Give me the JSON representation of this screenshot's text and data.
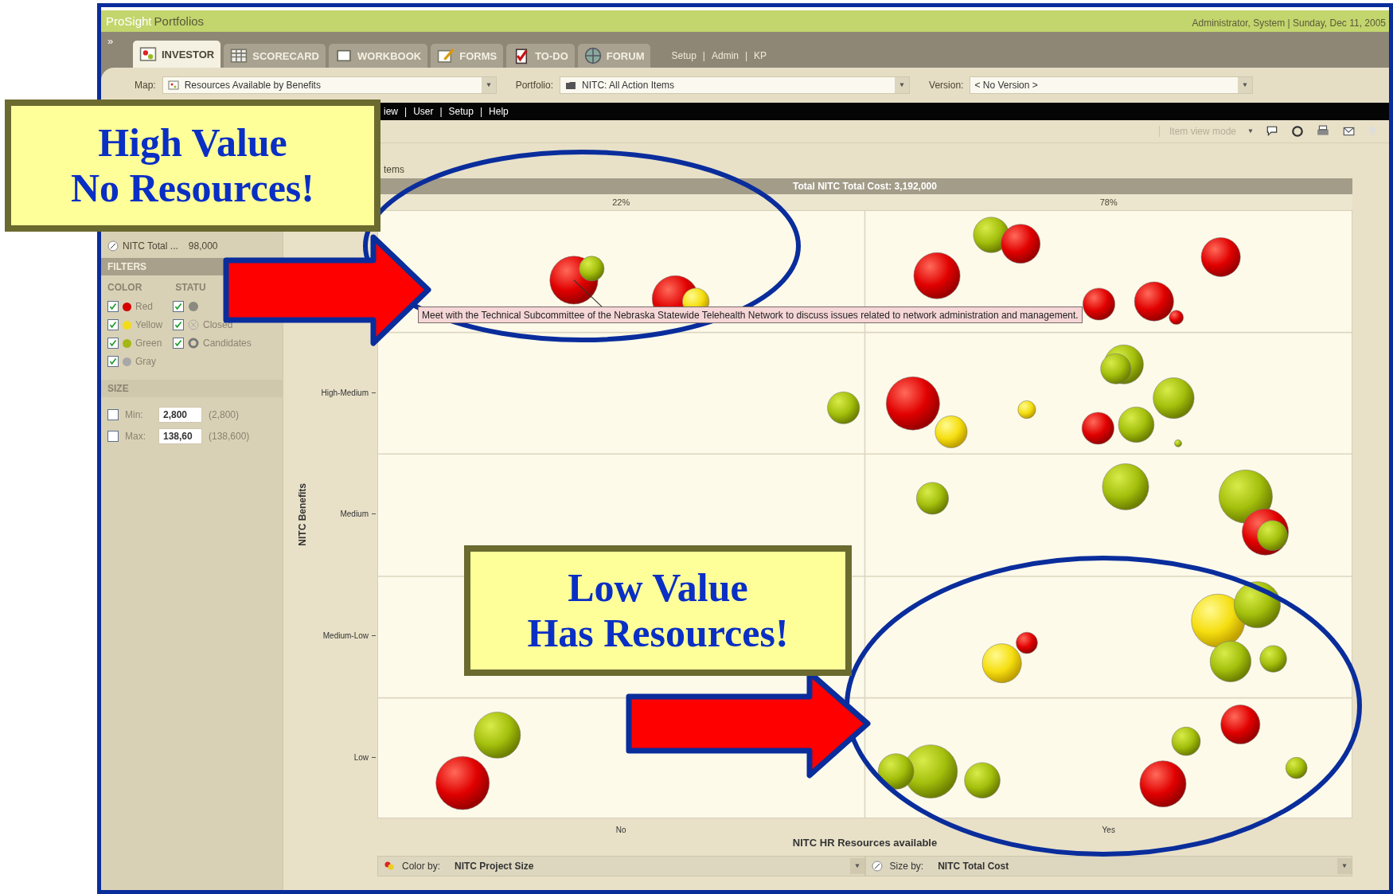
{
  "app": {
    "brand": "ProSight",
    "product": "Portfolios",
    "user_info": "Administrator, System | Sunday, Dec 11, 2005"
  },
  "tabs": [
    {
      "label": "INVESTOR",
      "selected": true,
      "kind": "investor"
    },
    {
      "label": "SCORECARD",
      "selected": false,
      "kind": "scorecard"
    },
    {
      "label": "WORKBOOK",
      "selected": false,
      "kind": "workbook"
    },
    {
      "label": "FORMS",
      "selected": false,
      "kind": "forms"
    },
    {
      "label": "TO-DO",
      "selected": false,
      "kind": "todo"
    },
    {
      "label": "FORUM",
      "selected": false,
      "kind": "forum"
    }
  ],
  "expander": "»",
  "nav": {
    "separator": "|",
    "links": [
      "Setup",
      "Admin",
      "KP"
    ]
  },
  "selectors": [
    {
      "label": "Map:",
      "value": "Resources Available by Benefits",
      "kind": "map"
    },
    {
      "label": "Portfolio:",
      "value": "NITC: All Action Items",
      "kind": "folder"
    },
    {
      "label": "Version:",
      "value": "< No Version >",
      "kind": "plain"
    }
  ],
  "menu": {
    "separator": "|",
    "items": [
      "iew",
      "User",
      "Setup",
      "Help"
    ]
  },
  "toolbar": {
    "view_mode": "Item view mode"
  },
  "legend": {
    "label": "NITC Total ...",
    "value": "98,000"
  },
  "filters": {
    "title": "FILTERS",
    "color_title": "COLOR",
    "status_title": "STATU",
    "colors": [
      {
        "label": "Red",
        "checked": true,
        "color": "#d40000"
      },
      {
        "label": "Yellow",
        "checked": true,
        "color": "#f2dc1a"
      },
      {
        "label": "Green",
        "checked": true,
        "color": "#a3b812"
      },
      {
        "label": "Gray",
        "checked": true,
        "color": "#a8a8a8"
      }
    ],
    "statuses": [
      {
        "checked": true,
        "kind": "open"
      },
      {
        "label": "Closed",
        "checked": true,
        "kind": "closed"
      },
      {
        "label": "Candidates",
        "checked": true,
        "kind": "candidates"
      }
    ]
  },
  "size": {
    "title": "SIZE",
    "rows": [
      {
        "label": "Min:",
        "checked": false,
        "value": "2,800",
        "range": "(2,800)"
      },
      {
        "label": "Max:",
        "checked": false,
        "value": "138,60",
        "range": "(138,600)"
      }
    ]
  },
  "chart": {
    "caption": "tems",
    "header": "Total NITC Total Cost: 3,192,000",
    "column_shares": [
      "22%",
      "78%"
    ],
    "ylabel": "NITC Benefits",
    "yticks": [
      "High-Medium",
      "Medium",
      "Medium-Low",
      "Low"
    ],
    "xticks": [
      "No",
      "Yes"
    ],
    "xlabel": "NITC HR Resources available",
    "tooltip": "Meet with the Technical Subcommittee of the Nebraska Statewide Telehealth Network to discuss issues related to network administration and management."
  },
  "bottom_bar": [
    {
      "label": "Color by:",
      "value": "NITC Project Size",
      "kind": "color"
    },
    {
      "label": "Size by:",
      "value": "NITC Total Cost",
      "kind": "size"
    }
  ],
  "callouts": [
    {
      "lines": [
        "High Value",
        "No Resources!"
      ]
    },
    {
      "lines": [
        "Low Value",
        "Has Resources!"
      ]
    }
  ]
}
